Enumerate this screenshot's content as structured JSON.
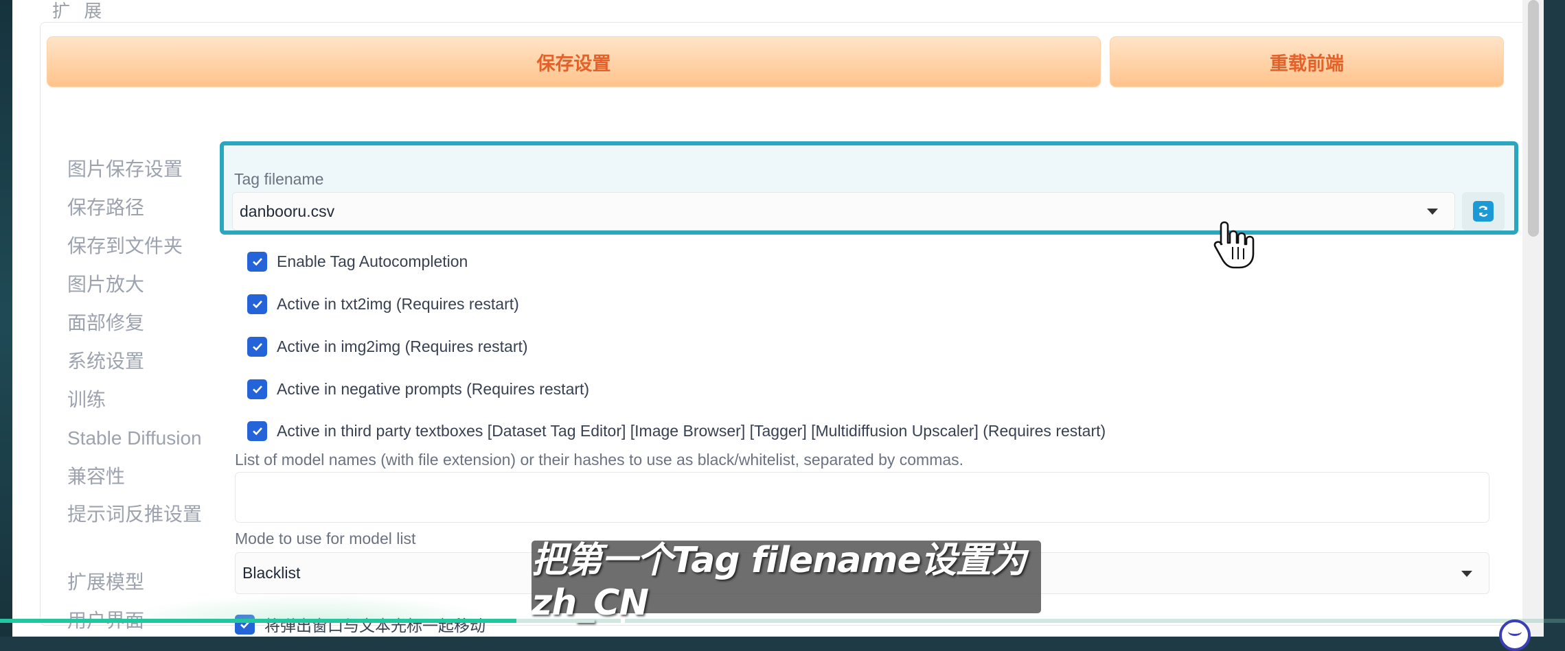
{
  "section": {
    "caption": "扩 展"
  },
  "toolbar": {
    "save_label": "保存设置",
    "reload_label": "重载前端"
  },
  "sidebar": {
    "items": [
      {
        "label": "图片保存设置"
      },
      {
        "label": "保存路径"
      },
      {
        "label": "保存到文件夹"
      },
      {
        "label": "图片放大"
      },
      {
        "label": "面部修复"
      },
      {
        "label": "系统设置"
      },
      {
        "label": "训练"
      },
      {
        "label": "Stable Diffusion"
      },
      {
        "label": "兼容性"
      },
      {
        "label": "提示词反推设置"
      },
      {
        "label": "扩展模型"
      },
      {
        "label": "用户界面"
      }
    ]
  },
  "settings": {
    "tag_filename": {
      "label": "Tag filename",
      "value": "danbooru.csv",
      "refresh_icon": "refresh-icon"
    },
    "checkboxes": [
      {
        "label": "Enable Tag Autocompletion",
        "checked": true
      },
      {
        "label": "Active in txt2img (Requires restart)",
        "checked": true
      },
      {
        "label": "Active in img2img (Requires restart)",
        "checked": true
      },
      {
        "label": "Active in negative prompts (Requires restart)",
        "checked": true
      },
      {
        "label": "Active in third party textboxes [Dataset Tag Editor] [Image Browser] [Tagger] [Multidiffusion Upscaler] (Requires restart)",
        "checked": true
      },
      {
        "label": "将弹出窗口与文本光标一起移动",
        "checked": true
      }
    ],
    "model_list": {
      "label": "List of model names (with file extension) or their hashes to use as black/whitelist, separated by commas.",
      "value": ""
    },
    "mode": {
      "label": "Mode to use for model list",
      "value": "Blacklist"
    }
  },
  "overlay": {
    "subtitle": "把第一个Tag filename设置为zh_CN",
    "progress": 0.33
  },
  "colors": {
    "accent_orange": "#e4622a",
    "focus_border": "#2aa6bf",
    "checkbox_blue": "#2563d9"
  }
}
